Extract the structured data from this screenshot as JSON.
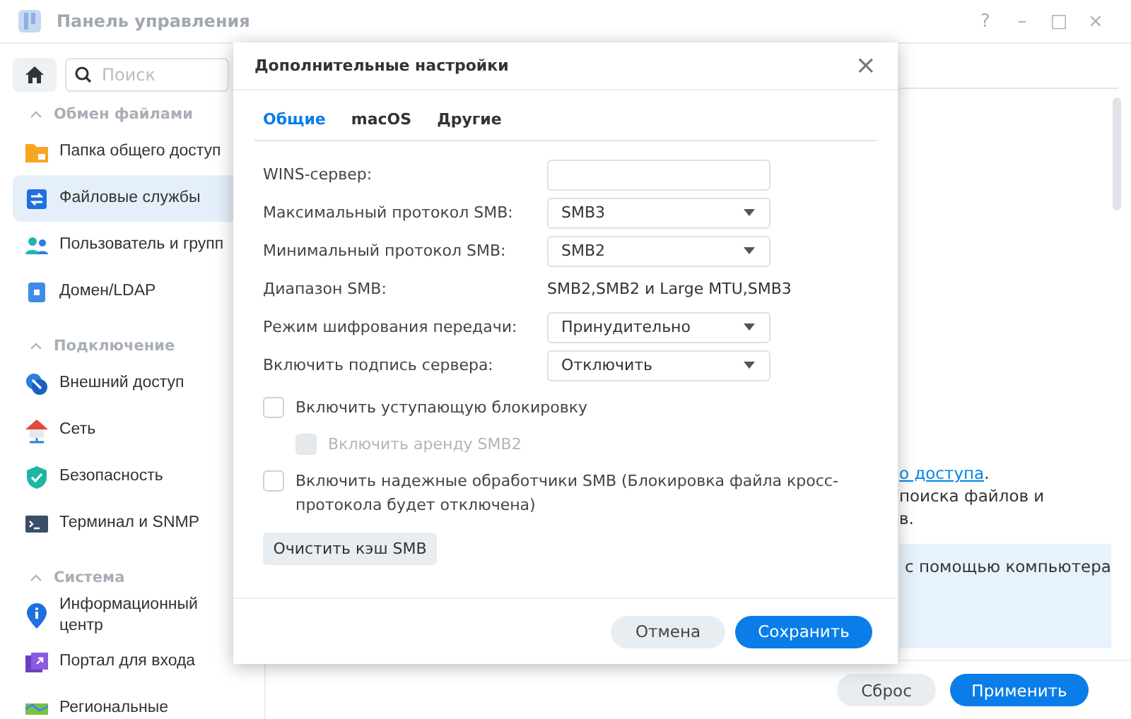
{
  "window": {
    "title": "Панель управления",
    "controls": [
      "?",
      "–",
      "□",
      "×"
    ]
  },
  "sidebar": {
    "search": {
      "placeholder": "Поиск"
    },
    "sections": [
      {
        "title": "Обмен файлами",
        "expanded": true,
        "items": [
          {
            "label": "Папка общего доступ",
            "selected": false
          },
          {
            "label": "Файловые службы",
            "selected": true
          },
          {
            "label": "Пользователь и групп",
            "selected": false
          },
          {
            "label": "Домен/LDAP",
            "selected": false
          }
        ]
      },
      {
        "title": "Подключение",
        "expanded": true,
        "items": [
          {
            "label": "Внешний доступ",
            "selected": false
          },
          {
            "label": "Сеть",
            "selected": false
          },
          {
            "label": "Безопасность",
            "selected": false
          },
          {
            "label": "Терминал и SNMP",
            "selected": false
          }
        ]
      },
      {
        "title": "Система",
        "expanded": true,
        "items": [
          {
            "label": "Информационный центр",
            "selected": false
          },
          {
            "label": "Портал для входа",
            "selected": false
          },
          {
            "label": "Региональные",
            "selected": false
          }
        ]
      }
    ]
  },
  "main": {
    "link_text": "о доступа",
    "after_link": ".",
    "lines": [
      "поиска файлов и",
      "в."
    ],
    "info": "с помощью компьютера",
    "buttons": [
      {
        "label": "Сброс",
        "kind": "secondary"
      },
      {
        "label": "Применить",
        "kind": "primary"
      }
    ]
  },
  "dialog": {
    "title": "Дополнительные настройки",
    "close": "×",
    "tabs": [
      {
        "label": "Общие",
        "selected": true
      },
      {
        "label": "macOS",
        "selected": false
      },
      {
        "label": "Другие",
        "selected": false
      }
    ],
    "fields": [
      {
        "label": "WINS-сервер:",
        "kind": "input"
      },
      {
        "label": "Максимальный протокол SMB:",
        "kind": "select",
        "value": "SMB3"
      },
      {
        "label": "Минимальный протокол SMB:",
        "kind": "select",
        "value": "SMB2"
      },
      {
        "label": "Диапазон SMB:",
        "kind": "text",
        "value": "SMB2,SMB2 и Large MTU,SMB3"
      },
      {
        "label": "Режим шифрования передачи:",
        "kind": "select",
        "value": "Принудительно"
      },
      {
        "label": "Включить подпись сервера:",
        "kind": "select",
        "value": "Отключить"
      }
    ],
    "checkboxes": [
      {
        "label": "Включить уступающую блокировку",
        "checked": false,
        "disabled": false,
        "children": [
          {
            "label": "Включить аренду SMB2",
            "checked": false,
            "disabled": true
          }
        ]
      },
      {
        "label": "Включить надежные обработчики SMB (Блокировка файла кросс-протокола будет отключена)",
        "checked": false,
        "disabled": false
      }
    ],
    "action_button": "Очистить кэш SMB",
    "buttons": [
      {
        "label": "Отмена",
        "kind": "secondary"
      },
      {
        "label": "Сохранить",
        "kind": "primary"
      }
    ]
  }
}
